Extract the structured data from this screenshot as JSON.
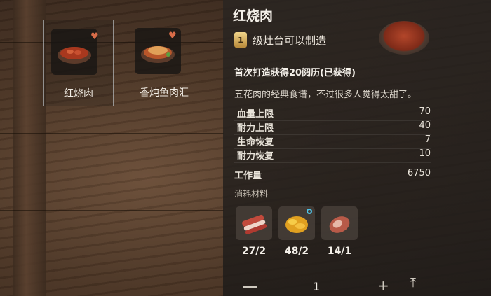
{
  "recipes": [
    {
      "label": "红烧肉",
      "selected": true
    },
    {
      "label": "香炖鱼肉汇",
      "selected": false
    }
  ],
  "detail": {
    "title": "红烧肉",
    "level_badge": "1",
    "level_text": "级灶台可以制造",
    "first_craft": "首次打造获得20阅历(已获得)",
    "description": "五花肉的经典食谱，不过很多人觉得太甜了。",
    "stats": [
      {
        "label": "血量上限",
        "value": "70"
      },
      {
        "label": "耐力上限",
        "value": "40"
      },
      {
        "label": "生命恢复",
        "value": "7"
      },
      {
        "label": "耐力恢复",
        "value": "10"
      }
    ],
    "workload_label": "工作量",
    "workload_value": "6750",
    "materials_label": "消耗材料",
    "materials": [
      {
        "icon": "pork-belly-icon",
        "count": "27/2"
      },
      {
        "icon": "golden-grain-icon",
        "count": "48/2"
      },
      {
        "icon": "meat-chunk-icon",
        "count": "14/1"
      }
    ]
  },
  "craft_bar": {
    "quantity": "1"
  },
  "colors": {
    "heart": "#d86c48",
    "panel_bg": "#2a2623",
    "bonus_ring": "#4fc3e8"
  }
}
